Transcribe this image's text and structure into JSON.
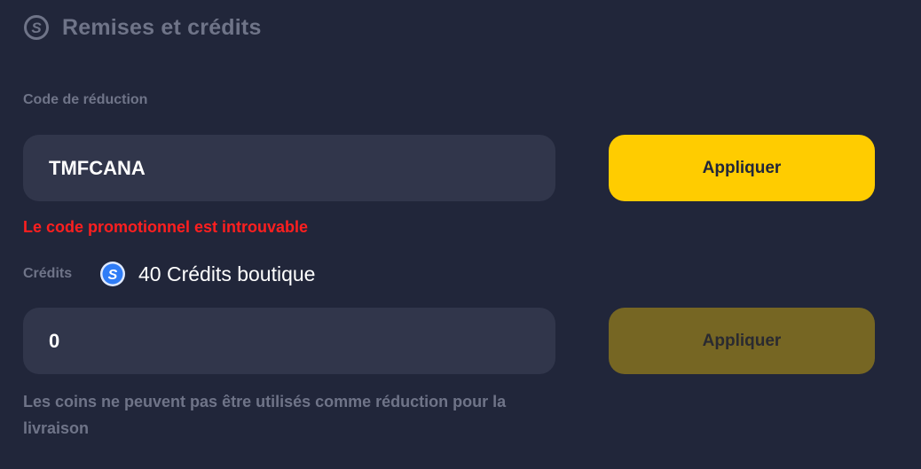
{
  "header": {
    "icon": "dollar-coin-icon",
    "title": "Remises et crédits"
  },
  "discount": {
    "label": "Code de réduction",
    "code_value": "TMFCANA",
    "apply_label": "Appliquer",
    "error_message": "Le code promotionnel est introuvable"
  },
  "credits": {
    "label": "Crédits",
    "icon": "shop-credit-coin-icon",
    "balance_text": "40 Crédits boutique",
    "input_value": "0",
    "apply_label": "Appliquer",
    "note": "Les coins ne peuvent pas être utilisés comme réduction pour la livraison"
  },
  "colors": {
    "background": "#21263a",
    "input_background": "#31364b",
    "accent": "#ffcc00",
    "accent_disabled": "#766623",
    "error": "#ff1f1f",
    "muted_text": "#6f7488"
  }
}
